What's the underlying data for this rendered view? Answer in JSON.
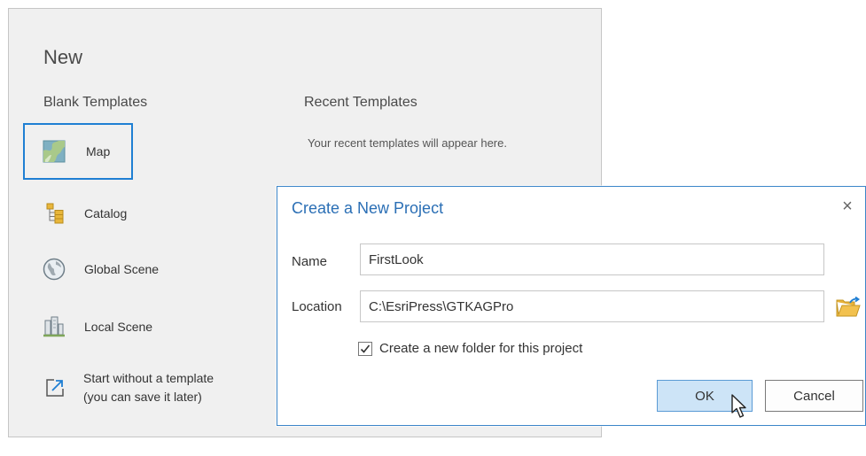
{
  "new_panel": {
    "title": "New",
    "blank_templates": {
      "heading": "Blank Templates",
      "items": [
        {
          "label": "Map",
          "icon": "map-icon",
          "selected": true
        },
        {
          "label": "Catalog",
          "icon": "catalog-icon"
        },
        {
          "label": "Global Scene",
          "icon": "globe-icon"
        },
        {
          "label": "Local Scene",
          "icon": "local-scene-icon"
        },
        {
          "label_line1": "Start without a template",
          "label_line2": "(you can save it later)",
          "icon": "open-external-icon"
        }
      ]
    },
    "recent_templates": {
      "heading": "Recent Templates",
      "empty_message": "Your recent templates will appear here."
    }
  },
  "dialog": {
    "title": "Create a New Project",
    "close_glyph": "×",
    "name_label": "Name",
    "name_value": "FirstLook",
    "location_label": "Location",
    "location_value": "C:\\EsriPress\\GTKAGPro",
    "create_folder_checked": true,
    "create_folder_label": "Create a new folder for this project",
    "ok_label": "OK",
    "cancel_label": "Cancel"
  },
  "colors": {
    "selection_border": "#1f7fd3",
    "dialog_title": "#2b6fb5",
    "ok_button_bg": "#cde4f7"
  }
}
